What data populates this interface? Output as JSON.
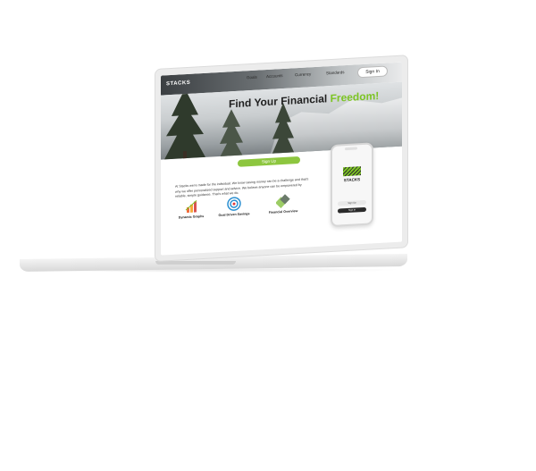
{
  "site": {
    "logo": "STACKS",
    "nav": [
      "Goals",
      "Accounts",
      "Currency",
      "Standards"
    ],
    "signin": "Sign In",
    "hero_title_main": "Find Your Financial ",
    "hero_title_accent": "Freedom!",
    "signup": "Sign Up",
    "about": "At Stacks we're made for the individual. We know saving money can be a challenge and that's why we offer personalized support and advice. We believe anyone can be empowered by reliable, simple guidance. That's what we do.",
    "features": [
      {
        "label": "Dynamic Graphs",
        "icon": "dynamic-graphs-icon"
      },
      {
        "label": "Goal Driven Savings",
        "icon": "target-icon"
      },
      {
        "label": "Financial Overview",
        "icon": "overview-icon"
      }
    ]
  },
  "phone": {
    "brand": "STACKS",
    "signup": "Sign Up",
    "signin": "Sign In"
  },
  "colors": {
    "accent": "#7cc424",
    "button": "#8dc63f",
    "dark": "#2b2b2b"
  }
}
